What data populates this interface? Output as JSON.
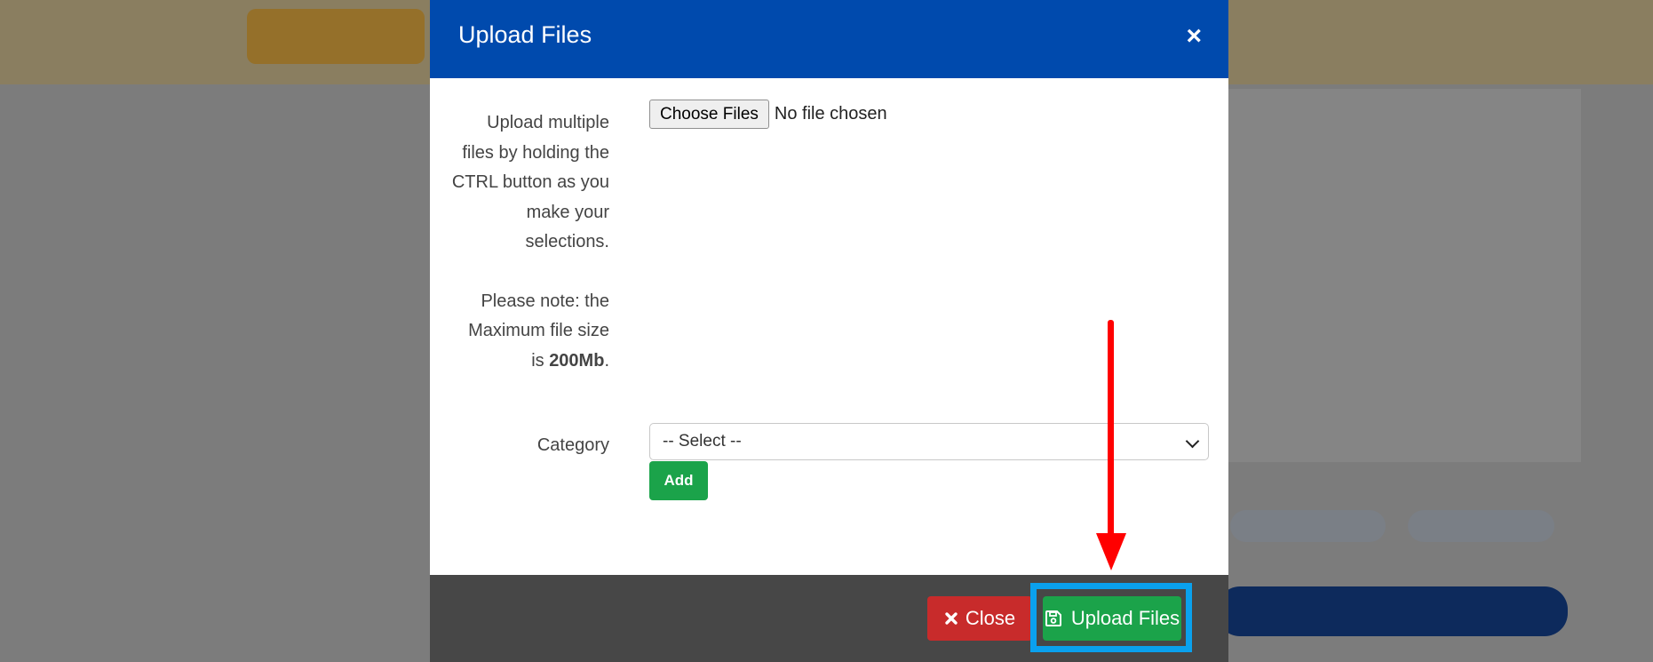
{
  "modal": {
    "title": "Upload Files",
    "close_symbol": "×",
    "help_text": {
      "line1": "Upload multiple",
      "line2": "files by holding the",
      "line3": "CTRL button as you",
      "line4": "make your",
      "line5": "selections.",
      "note1": "Please note: the",
      "note2": "Maximum file size",
      "note3_prefix": "is ",
      "note3_size": "200Mb",
      "note3_suffix": "."
    },
    "file_input": {
      "button_label": "Choose Files",
      "status": "No file chosen"
    },
    "category": {
      "label": "Category",
      "selected": "-- Select --"
    },
    "add_button": "Add",
    "footer": {
      "close_label": "Close",
      "upload_label": "Upload Files"
    }
  },
  "icons": {
    "close_icon": "close-icon",
    "close_button_icon": "x-icon",
    "upload_icon": "save-icon",
    "dropdown_icon": "chevron-down-icon"
  },
  "colors": {
    "header": "#004aad",
    "close_button": "#c82b2b",
    "upload_button": "#1ba34a",
    "add_button": "#1ba34a",
    "highlight": "#0aa1ee",
    "arrow": "#ff0000",
    "footer": "#474747"
  }
}
